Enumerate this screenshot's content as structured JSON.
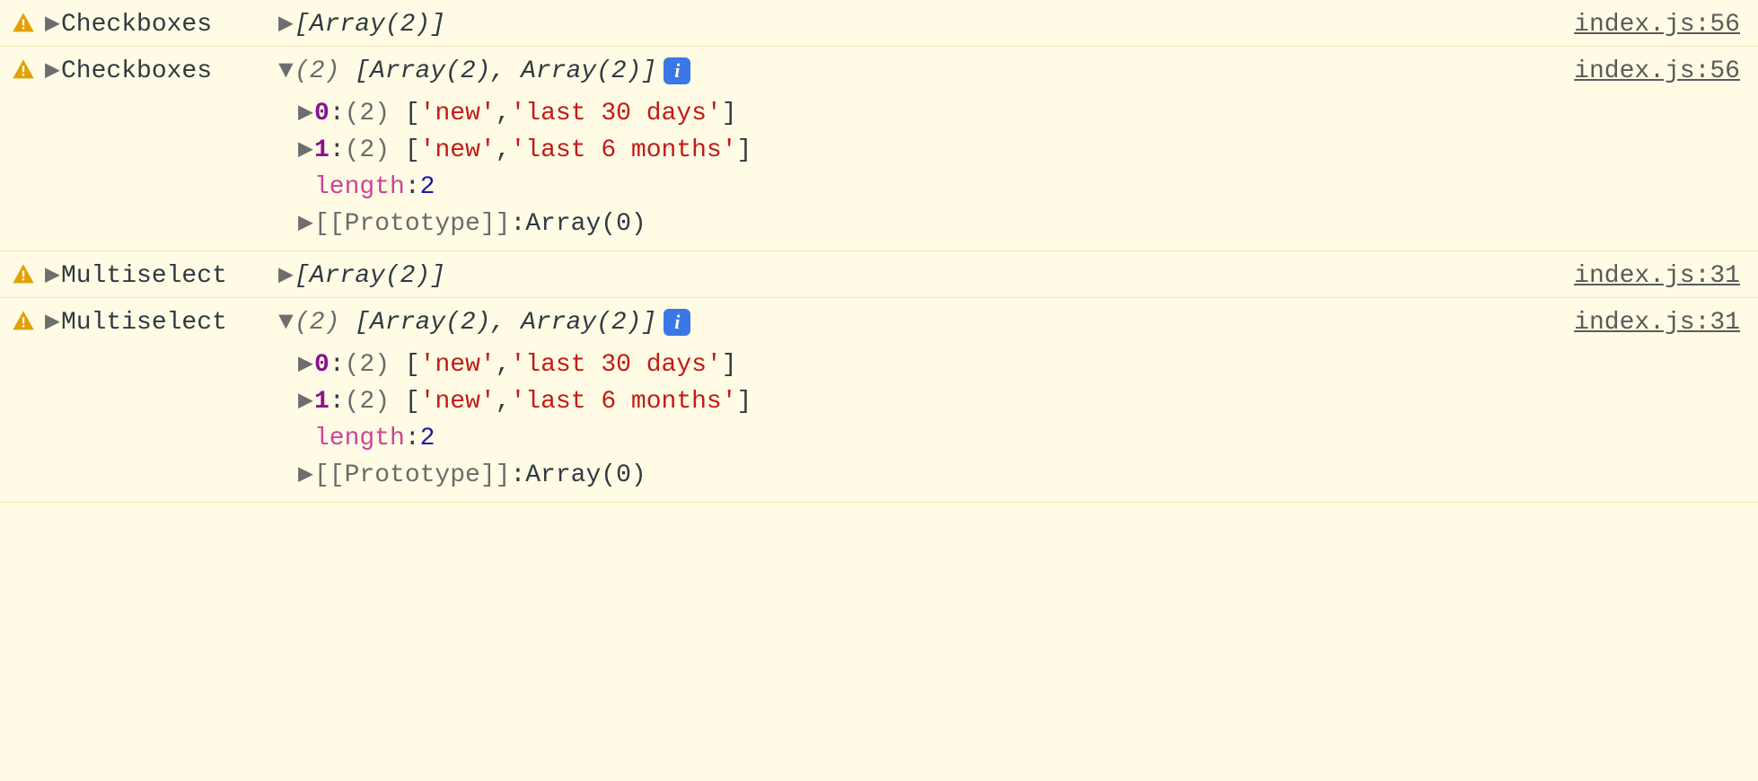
{
  "rows": [
    {
      "label": "Checkboxes",
      "summary": "[Array(2)]",
      "source": "index.js:56",
      "expanded": false
    },
    {
      "label": "Checkboxes",
      "summary_count": "(2)",
      "summary_body": "[Array(2), Array(2)]",
      "source": "index.js:56",
      "expanded": true,
      "items": [
        {
          "key": "0",
          "count": "(2)",
          "open": "[",
          "v0": "'new'",
          "sep": ", ",
          "v1": "'last 30 days'",
          "close": "]"
        },
        {
          "key": "1",
          "count": "(2)",
          "open": "[",
          "v0": "'new'",
          "sep": ", ",
          "v1": "'last 6 months'",
          "close": "]"
        }
      ],
      "length_key": "length",
      "length_val": "2",
      "proto_key": "[[Prototype]]",
      "proto_val": "Array(0)"
    },
    {
      "label": "Multiselect",
      "summary": "[Array(2)]",
      "source": "index.js:31",
      "expanded": false
    },
    {
      "label": "Multiselect",
      "summary_count": "(2)",
      "summary_body": "[Array(2), Array(2)]",
      "source": "index.js:31",
      "expanded": true,
      "items": [
        {
          "key": "0",
          "count": "(2)",
          "open": "[",
          "v0": "'new'",
          "sep": ", ",
          "v1": "'last 30 days'",
          "close": "]"
        },
        {
          "key": "1",
          "count": "(2)",
          "open": "[",
          "v0": "'new'",
          "sep": ", ",
          "v1": "'last 6 months'",
          "close": "]"
        }
      ],
      "length_key": "length",
      "length_val": "2",
      "proto_key": "[[Prototype]]",
      "proto_val": "Array(0)"
    }
  ],
  "glyph": {
    "right": "▶",
    "down": "▼",
    "info": "i",
    "colon": ":",
    "colon_sp": ": "
  }
}
